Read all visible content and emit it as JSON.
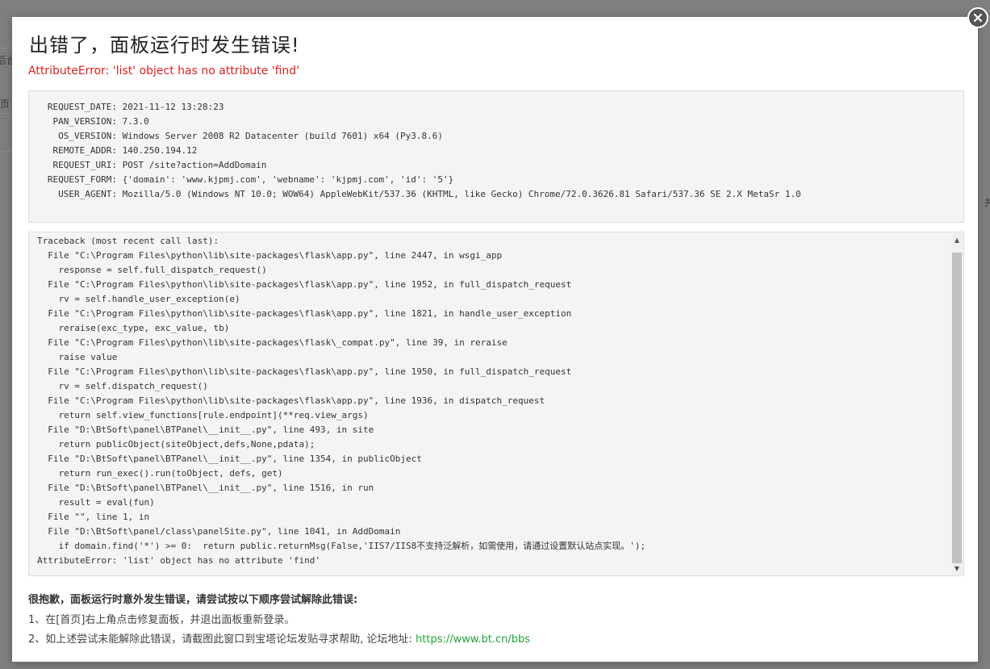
{
  "dialog": {
    "title": "出错了，面板运行时发生错误!",
    "error_summary": "AttributeError: 'list' object has no attribute 'find'"
  },
  "request_info": [
    {
      "key": "REQUEST_DATE",
      "value": "2021-11-12 13:28:23"
    },
    {
      "key": "PAN_VERSION",
      "value": "7.3.0"
    },
    {
      "key": "OS_VERSION",
      "value": "Windows Server 2008 R2 Datacenter (build 7601) x64 (Py3.8.6)"
    },
    {
      "key": "REMOTE_ADDR",
      "value": "140.250.194.12"
    },
    {
      "key": "REQUEST_URI",
      "value": "POST /site?action=AddDomain"
    },
    {
      "key": "REQUEST_FORM",
      "value": "{'domain': 'www.kjpmj.com', 'webname': 'kjpmj.com', 'id': '5'}"
    },
    {
      "key": "USER_AGENT",
      "value": "Mozilla/5.0 (Windows NT 10.0; WOW64) AppleWebKit/537.36 (KHTML, like Gecko) Chrome/72.0.3626.81 Safari/537.36 SE 2.X MetaSr 1.0"
    }
  ],
  "traceback": [
    "Traceback (most recent call last):",
    "  File \"C:\\Program Files\\python\\lib\\site-packages\\flask\\app.py\", line 2447, in wsgi_app",
    "    response = self.full_dispatch_request()",
    "  File \"C:\\Program Files\\python\\lib\\site-packages\\flask\\app.py\", line 1952, in full_dispatch_request",
    "    rv = self.handle_user_exception(e)",
    "  File \"C:\\Program Files\\python\\lib\\site-packages\\flask\\app.py\", line 1821, in handle_user_exception",
    "    reraise(exc_type, exc_value, tb)",
    "  File \"C:\\Program Files\\python\\lib\\site-packages\\flask\\_compat.py\", line 39, in reraise",
    "    raise value",
    "  File \"C:\\Program Files\\python\\lib\\site-packages\\flask\\app.py\", line 1950, in full_dispatch_request",
    "    rv = self.dispatch_request()",
    "  File \"C:\\Program Files\\python\\lib\\site-packages\\flask\\app.py\", line 1936, in dispatch_request",
    "    return self.view_functions[rule.endpoint](**req.view_args)",
    "  File \"D:\\BtSoft\\panel\\BTPanel\\__init__.py\", line 493, in site",
    "    return publicObject(siteObject,defs,None,pdata);",
    "  File \"D:\\BtSoft\\panel\\BTPanel\\__init__.py\", line 1354, in publicObject",
    "    return run_exec().run(toObject, defs, get)",
    "  File \"D:\\BtSoft\\panel\\BTPanel\\__init__.py\", line 1516, in run",
    "    result = eval(fun)",
    "  File \"\", line 1, in",
    "  File \"D:\\BtSoft\\panel/class\\panelSite.py\", line 1041, in AddDomain",
    "    if domain.find('*') >= 0:  return public.returnMsg(False,'IIS7/IIS8不支持泛解析，如需使用，请通过设置默认站点实现。');",
    "AttributeError: 'list' object has no attribute 'find'"
  ],
  "help": {
    "heading": "很抱歉，面板运行时意外发生错误，请尝试按以下顺序尝试解除此错误:",
    "step1": "1、在[首页]右上角点击修复面板，并退出面板重新登录。",
    "step2_text": "2、如上述尝试未能解除此错误，请截图此窗口到宝塔论坛发贴寻求帮助, 论坛地址: ",
    "step2_link": "https://www.bt.cn/bbs"
  },
  "backdrop": {
    "left_fragment_1": "后台",
    "left_fragment_2": "页",
    "right_fragment": "共"
  },
  "colors": {
    "error_red": "#e02020",
    "link_green": "#20a53a",
    "close_button": "#555555"
  },
  "icons": {
    "close": "close-icon",
    "scroll_up": "scroll-up-arrow-icon",
    "scroll_down": "scroll-down-arrow-icon"
  }
}
